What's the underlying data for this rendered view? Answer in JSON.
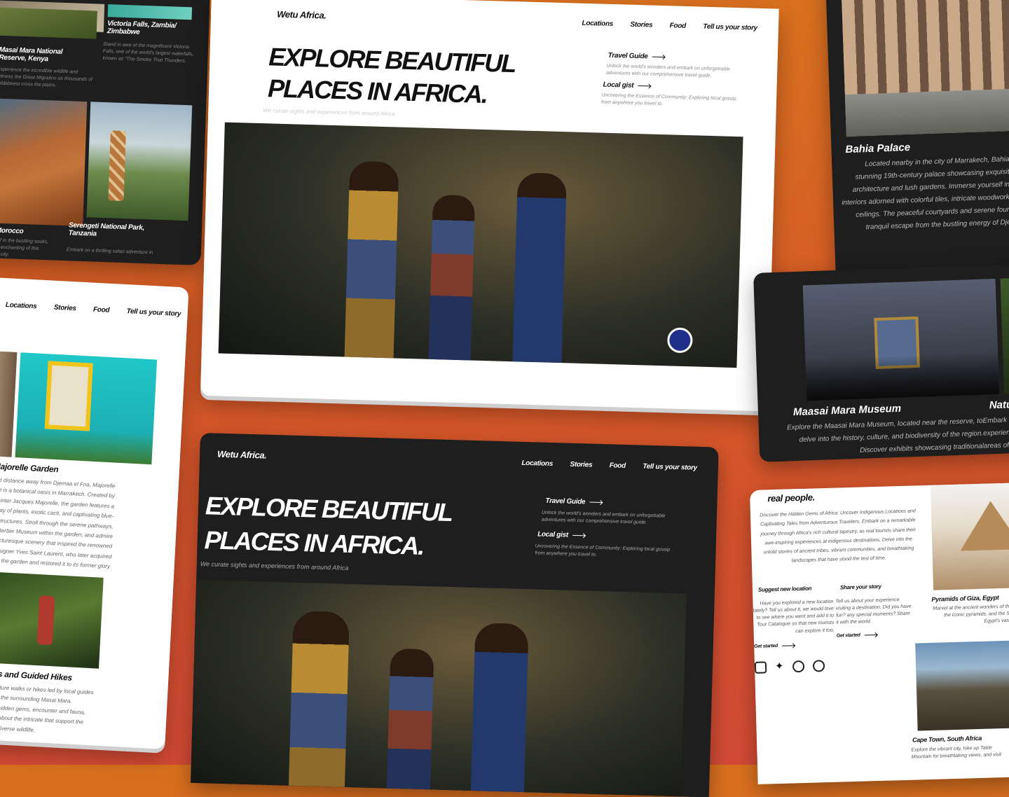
{
  "brand": "Wetu Africa.",
  "nav": [
    "Locations",
    "Stories",
    "Food",
    "Tell us your story"
  ],
  "hero": {
    "line1": "EXPLORE BEAUTIFUL",
    "line2": "PLACES IN AFRICA.",
    "subtitle": "We curate sights and experiences from around Africa"
  },
  "links": {
    "guide_title": "Travel Guide",
    "guide_text": "Unlock the world's wonders and embark on unforgettable adventures with our comprehensive travel guide.",
    "gist_title": "Local gist",
    "gist_text": "Uncovering the Essence of Community: Exploring local gossip from anywhere you travel to."
  },
  "topleft": {
    "victoria_title": "Victoria Falls, Zambia/ Zimbabwe",
    "victoria_text": "Stand in awe of the magnificent Victoria Falls, one of the world's largest waterfalls, known as \"The Smoke That Thunders.",
    "masai_title": "Masai Mara National Reserve, Kenya",
    "masai_text": "Experience the incredible wildlife and witness the Great Migration as thousands of wildebeest cross the plains.",
    "morocco_title": "ch, Morocco",
    "morocco_text": "yourself in the bustling souks, ra, and enchanting of this historic city.",
    "serengeti_title": "Serengeti National Park, Tanzania",
    "serengeti_text": "Embark on a thrilling safari adventure in"
  },
  "topright": {
    "bahia_title": "Bahia Palace",
    "bahia_text": "Located nearby in the city of Marrakech, Bahia Palace is a stunning 19th-century palace showcasing exquisite Moroccan architecture and lush gardens. Immerse yourself in the opulent interiors adorned with colorful tiles, intricate woodwork, and ornate ceilings. The peaceful courtyards and serene fountains offer a tranquil escape from the bustling energy of Djemaa el Fna.",
    "museum_title": "Maasai Mara Museum",
    "museum_text": "Explore the Maasai Mara Museum, located near the reserve, to delve into the history, culture, and biodiversity of the region. Discover exhibits showcasing traditional",
    "nature_title": "Natur",
    "nature_text": "Embark experienc areas of M"
  },
  "left": {
    "majorelle_title": "Majorelle Garden",
    "majorelle_text": "A short distance away from Djemaa el Fna, Majorelle Garden is a botanical oasis in Marrakech. Created by French painter Jacques Majorelle, the garden features a vibrant array of plants, exotic cacti, and captivating blue-painted structures. Stroll through the serene pathways, visit the Berber Museum within the garden, and admire the picturesque scenery that inspired the renowned fashion designer Yves Saint Laurent, who later acquired the garden and restored it to its former glory.",
    "hikes_title": "Walks and Guided Hikes",
    "hikes_text": "guided nature walks or hikes led by local guides to explore the surrounding Masai Mara. Discover hidden gems, encounter and fauna, and learn about the intricate that support the reserve's diverse wildlife."
  },
  "bottomright": {
    "heading": "real people.",
    "intro": "Discover the Hidden Gems of Africa: Uncover Indigenous Locations and Captivating Tales from Adventurous Travelers. Embark on a remarkable journey through Africa's rich cultural tapestry, as real tourists share their awe-inspiring experiences at indigenous destinations. Delve into the untold stories of ancient tribes, vibrant communities, and breathtaking landscapes that have stood the test of time.",
    "suggest_title": "Suggest new location",
    "suggest_text": "Have you explored a new location lately? Tell us about it, we would love to see where you went and add it to Tour Catalogue so that new tourists can explore it too.",
    "share_title": "Share your story",
    "share_text": "Tell us about your experience visiting a destination. Did you have fun? any special moments? Share it with the world.",
    "cta": "Get started",
    "giza_title": "Pyramids of Giza, Egypt",
    "giza_text": "Marvel at the ancient wonders of the world, the iconic pyramids, and the Sphinx in Egypt's vast desert.",
    "cape_title": "Cape Town, South Africa",
    "cape_text": "Explore the vibrant city, hike up Table Mountain for breathtaking views, and visit"
  },
  "colors": {
    "accent": "#d8701f",
    "dark_panel": "#1e1e1e",
    "light_panel": "#ffffff"
  },
  "icons": [
    "instagram-icon",
    "twitter-icon",
    "dribbble-icon",
    "threads-icon"
  ]
}
